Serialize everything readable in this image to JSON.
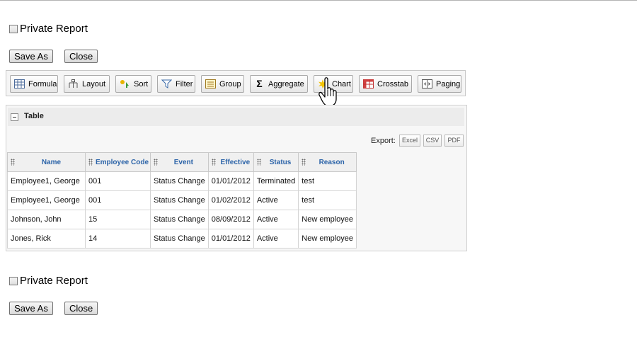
{
  "form": {
    "private_report_label": "Private Report",
    "save_as_label": "Save As",
    "close_label": "Close"
  },
  "toolbar": {
    "formula": "Formula",
    "layout": "Layout",
    "sort": "Sort",
    "filter": "Filter",
    "group": "Group",
    "aggregate": "Aggregate",
    "chart": "Chart",
    "crosstab": "Crosstab",
    "paging": "Paging"
  },
  "panel": {
    "title": "Table",
    "export_label": "Export:",
    "export_excel": "Excel",
    "export_csv": "CSV",
    "export_pdf": "PDF"
  },
  "table": {
    "headers": [
      "Name",
      "Employee Code",
      "Event",
      "Effective",
      "Status",
      "Reason"
    ],
    "rows": [
      [
        "Employee1, George",
        "001",
        "Status Change",
        "01/01/2012",
        "Terminated",
        "test"
      ],
      [
        "Employee1, George",
        "001",
        "Status Change",
        "01/02/2012",
        "Active",
        "test"
      ],
      [
        "Johnson, John",
        "15",
        "Status Change",
        "08/09/2012",
        "Active",
        "New employee"
      ],
      [
        "Jones, Rick",
        "14",
        "Status Change",
        "01/01/2012",
        "Active",
        "New employee"
      ]
    ]
  },
  "colors": {
    "header_text": "#2b63a8",
    "chart_highlight": "#f2c200"
  }
}
